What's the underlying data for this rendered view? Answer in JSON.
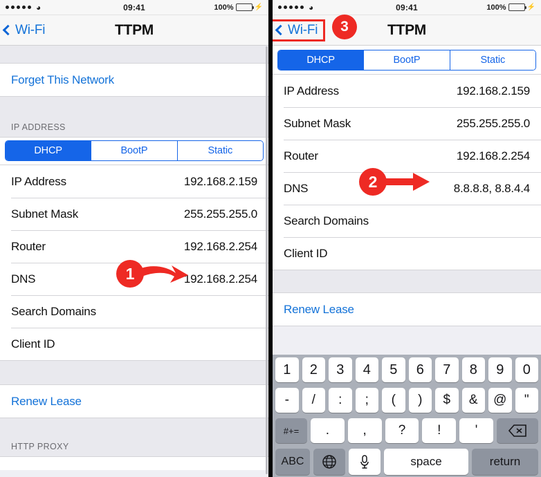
{
  "status_bar": {
    "signal_dots": 5,
    "wifi_icon": "wifi-icon",
    "time": "09:41",
    "battery_percent": "100%",
    "charging_icon": "lightning-bolt-icon"
  },
  "nav": {
    "back_label": "Wi-Fi",
    "back_icon": "chevron-left-icon",
    "title": "TTPM"
  },
  "left_panel": {
    "forget_network_label": "Forget This Network",
    "section_header": "IP ADDRESS",
    "segmented": {
      "options": [
        "DHCP",
        "BootP",
        "Static"
      ],
      "selected": "DHCP"
    },
    "rows": [
      {
        "label": "IP Address",
        "value": "192.168.2.159"
      },
      {
        "label": "Subnet Mask",
        "value": "255.255.255.0"
      },
      {
        "label": "Router",
        "value": "192.168.2.254"
      },
      {
        "label": "DNS",
        "value": "192.168.2.254"
      },
      {
        "label": "Search Domains",
        "value": ""
      },
      {
        "label": "Client ID",
        "value": ""
      }
    ],
    "renew_lease_label": "Renew Lease",
    "http_proxy_header": "HTTP PROXY"
  },
  "right_panel": {
    "segmented": {
      "options": [
        "DHCP",
        "BootP",
        "Static"
      ],
      "selected": "DHCP"
    },
    "rows": [
      {
        "label": "IP Address",
        "value": "192.168.2.159"
      },
      {
        "label": "Subnet Mask",
        "value": "255.255.255.0"
      },
      {
        "label": "Router",
        "value": "192.168.2.254"
      },
      {
        "label": "DNS",
        "value": "8.8.8.8,  8.8.4.4"
      },
      {
        "label": "Search Domains",
        "value": ""
      },
      {
        "label": "Client ID",
        "value": ""
      }
    ],
    "renew_lease_label": "Renew Lease"
  },
  "keyboard": {
    "row1": [
      "1",
      "2",
      "3",
      "4",
      "5",
      "6",
      "7",
      "8",
      "9",
      "0"
    ],
    "row2": [
      "-",
      "/",
      ":",
      ";",
      "(",
      ")",
      "$",
      "&",
      "@",
      "\""
    ],
    "row3_shift": "#+=",
    "row3": [
      ".",
      ",",
      "?",
      "!",
      "'"
    ],
    "backspace_icon": "backspace-icon",
    "abc_label": "ABC",
    "globe_icon": "globe-icon",
    "mic_icon": "microphone-icon",
    "space_label": "space",
    "return_label": "return"
  },
  "annotations": [
    {
      "number": "1",
      "target": "left-dns-value"
    },
    {
      "number": "2",
      "target": "right-dns-value"
    },
    {
      "number": "3",
      "target": "right-back-button"
    }
  ],
  "colors": {
    "accent_blue": "#1565e8",
    "link_blue": "#1372d8",
    "annotation_red": "#ee2a24",
    "battery_green": "#2fbf33",
    "keyboard_bg": "#abb0b9"
  }
}
